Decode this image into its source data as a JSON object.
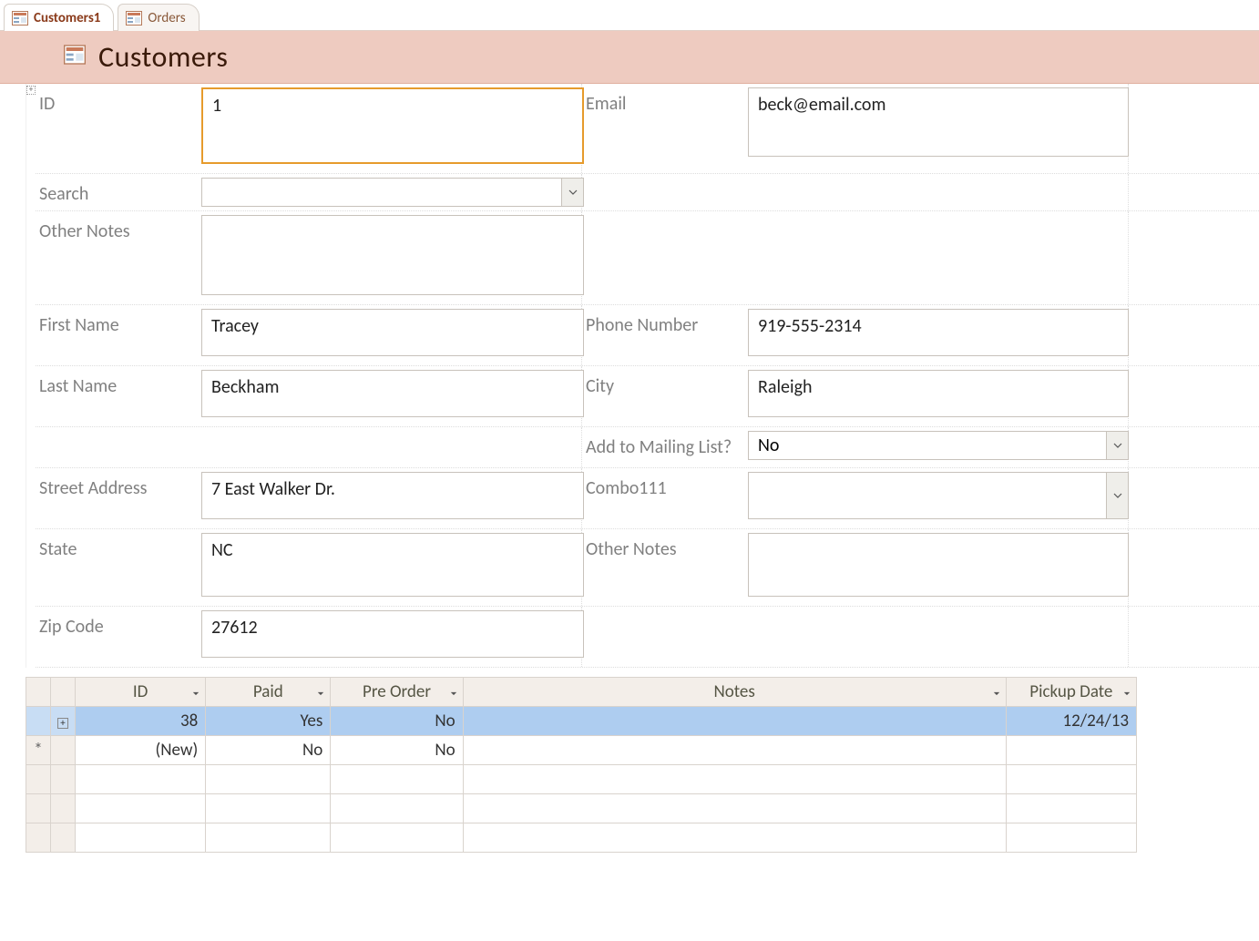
{
  "tabs": [
    {
      "label": "Customers1",
      "active": true
    },
    {
      "label": "Orders",
      "active": false
    }
  ],
  "header": {
    "title": "Customers"
  },
  "fields": {
    "id": {
      "label": "ID",
      "value": "1"
    },
    "email": {
      "label": "Email",
      "value": "beck@email.com"
    },
    "search": {
      "label": "Search",
      "value": ""
    },
    "other_notes": {
      "label": "Other Notes",
      "value": ""
    },
    "first_name": {
      "label": "First Name",
      "value": "Tracey"
    },
    "phone": {
      "label": "Phone Number",
      "value": "919-555-2314"
    },
    "last_name": {
      "label": "Last Name",
      "value": "Beckham"
    },
    "city": {
      "label": "City",
      "value": "Raleigh"
    },
    "mailing": {
      "label": "Add to Mailing List?",
      "value": "No"
    },
    "street": {
      "label": "Street Address",
      "value": "7 East Walker Dr."
    },
    "combo111": {
      "label": "Combo111",
      "value": ""
    },
    "state": {
      "label": "State",
      "value": "NC"
    },
    "other_notes2": {
      "label": "Other Notes",
      "value": ""
    },
    "zip": {
      "label": "Zip Code",
      "value": "27612"
    }
  },
  "datasheet": {
    "columns": [
      "ID",
      "Paid",
      "Pre Order",
      "Notes",
      "Pickup Date"
    ],
    "rows": [
      {
        "selector": "",
        "expand": "+",
        "id": "38",
        "paid": "Yes",
        "pre": "No",
        "notes": "",
        "pickup": "12/24/13",
        "selected": true
      },
      {
        "selector": "*",
        "expand": "",
        "id": "(New)",
        "paid": "No",
        "pre": "No",
        "notes": "",
        "pickup": "",
        "selected": false
      }
    ]
  }
}
